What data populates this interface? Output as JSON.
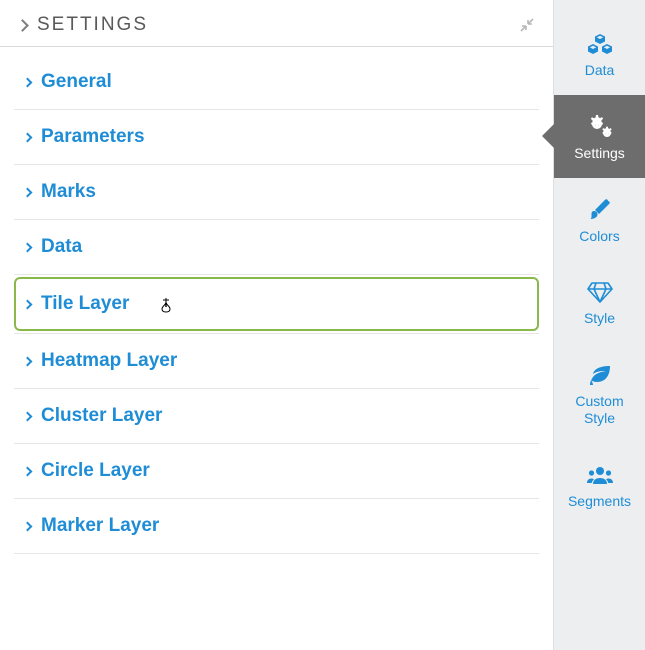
{
  "header": {
    "title": "SETTINGS"
  },
  "sections": [
    {
      "label": "General"
    },
    {
      "label": "Parameters"
    },
    {
      "label": "Marks"
    },
    {
      "label": "Data"
    },
    {
      "label": "Tile Layer",
      "highlight": true
    },
    {
      "label": "Heatmap Layer"
    },
    {
      "label": "Cluster Layer"
    },
    {
      "label": "Circle Layer"
    },
    {
      "label": "Marker Layer"
    }
  ],
  "tabs": [
    {
      "label": "Data",
      "icon": "cubes-icon"
    },
    {
      "label": "Settings",
      "icon": "gears-icon",
      "active": true
    },
    {
      "label": "Colors",
      "icon": "brush-icon"
    },
    {
      "label": "Style",
      "icon": "diamond-icon"
    },
    {
      "label": "Custom Style",
      "icon": "leaf-icon"
    },
    {
      "label": "Segments",
      "icon": "users-icon"
    }
  ]
}
